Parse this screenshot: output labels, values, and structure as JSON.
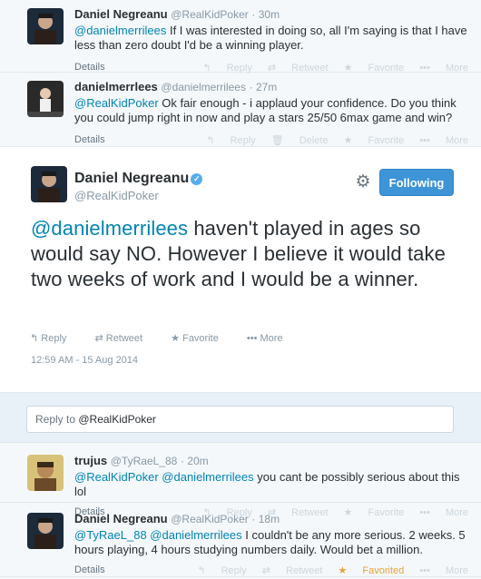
{
  "tweets_above": [
    {
      "name": "Daniel Negreanu",
      "handle": "@RealKidPoker",
      "time": "30m",
      "mention": "@danielmerrilees",
      "text": " If I was interested in doing so, all I'm saying is that I have less than zero doubt I'd be a winning player.",
      "details": "Details",
      "actions": [
        "Reply",
        "Retweet",
        "Favorite",
        "More"
      ]
    },
    {
      "name": "danielmerrlees",
      "handle": "@danielmerrilees",
      "time": "27m",
      "mention": "@RealKidPoker",
      "text": " Ok fair enough - i applaud your confidence. Do you think you could jump right in now and play a stars 25/50 6max game and win?",
      "details": "Details",
      "actions": [
        "Reply",
        "Delete",
        "Favorite",
        "More"
      ]
    }
  ],
  "main_tweet": {
    "name": "Daniel Negreanu",
    "handle": "@RealKidPoker",
    "follow_label": "Following",
    "mention": "@danielmerrilees",
    "text": " haven't played in ages so would say NO. However I believe it would take two weeks of work and I would be a winner.",
    "actions": [
      "Reply",
      "Retweet",
      "Favorite",
      "More"
    ],
    "timestamp": "12:59 AM - 15 Aug 2014"
  },
  "reply_box": {
    "prefix": "Reply to ",
    "mention": "@RealKidPoker"
  },
  "replies": [
    {
      "name": "trujus",
      "handle": "@TyRaeL_88",
      "time": "20m",
      "mention": "@RealKidPoker @danielmerrilees",
      "text": " you cant be possibly serious about this lol",
      "details": "Details",
      "actions": [
        "Reply",
        "Retweet",
        "Favorite",
        "More"
      ]
    },
    {
      "name": "Daniel Negreanu",
      "handle": "@RealKidPoker",
      "time": "18m",
      "mention": "@TyRaeL_88 @danielmerrilees",
      "text": " I couldn't be any more serious. 2 weeks. 5 hours playing, 4 hours studying numbers daily. Would bet a million.",
      "details": "Details",
      "actions": [
        "Reply",
        "Retweet",
        "Favorited",
        "More"
      ]
    }
  ],
  "colors": {
    "link": "#0084b4",
    "follow_button": "#3d94d6",
    "favorited": "#e8a13a"
  }
}
